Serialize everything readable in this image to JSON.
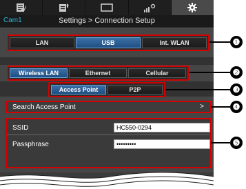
{
  "tabs": [
    {
      "icon": "status-list-icon"
    },
    {
      "icon": "file-upload-icon"
    },
    {
      "icon": "display-icon"
    },
    {
      "icon": "stats-gear-icon"
    },
    {
      "icon": "settings-gear-icon",
      "active": true
    }
  ],
  "header": {
    "camera": "Cam1",
    "breadcrumb": "Settings > Connection Setup"
  },
  "connection_type": {
    "options": [
      "LAN",
      "USB",
      "Int. WLAN"
    ],
    "selected": "USB"
  },
  "network_type": {
    "options": [
      "Wireless LAN",
      "Ethernet",
      "Cellular"
    ],
    "selected": "Wireless LAN"
  },
  "wlan_mode": {
    "options": [
      "Access Point",
      "P2P"
    ],
    "selected": "Access Point"
  },
  "search": {
    "label": "Search Access Point",
    "arrow": ">"
  },
  "ssid": {
    "label": "SSID",
    "value": "HC550-0294"
  },
  "passphrase": {
    "label": "Passphrase",
    "value": "•••••••••"
  },
  "callouts": [
    "❶",
    "❷",
    "❸",
    "❹",
    "❺"
  ],
  "colors": {
    "highlight": "#d40000",
    "selected": "#2f6aa3",
    "camera_label": "#27b6d8"
  }
}
